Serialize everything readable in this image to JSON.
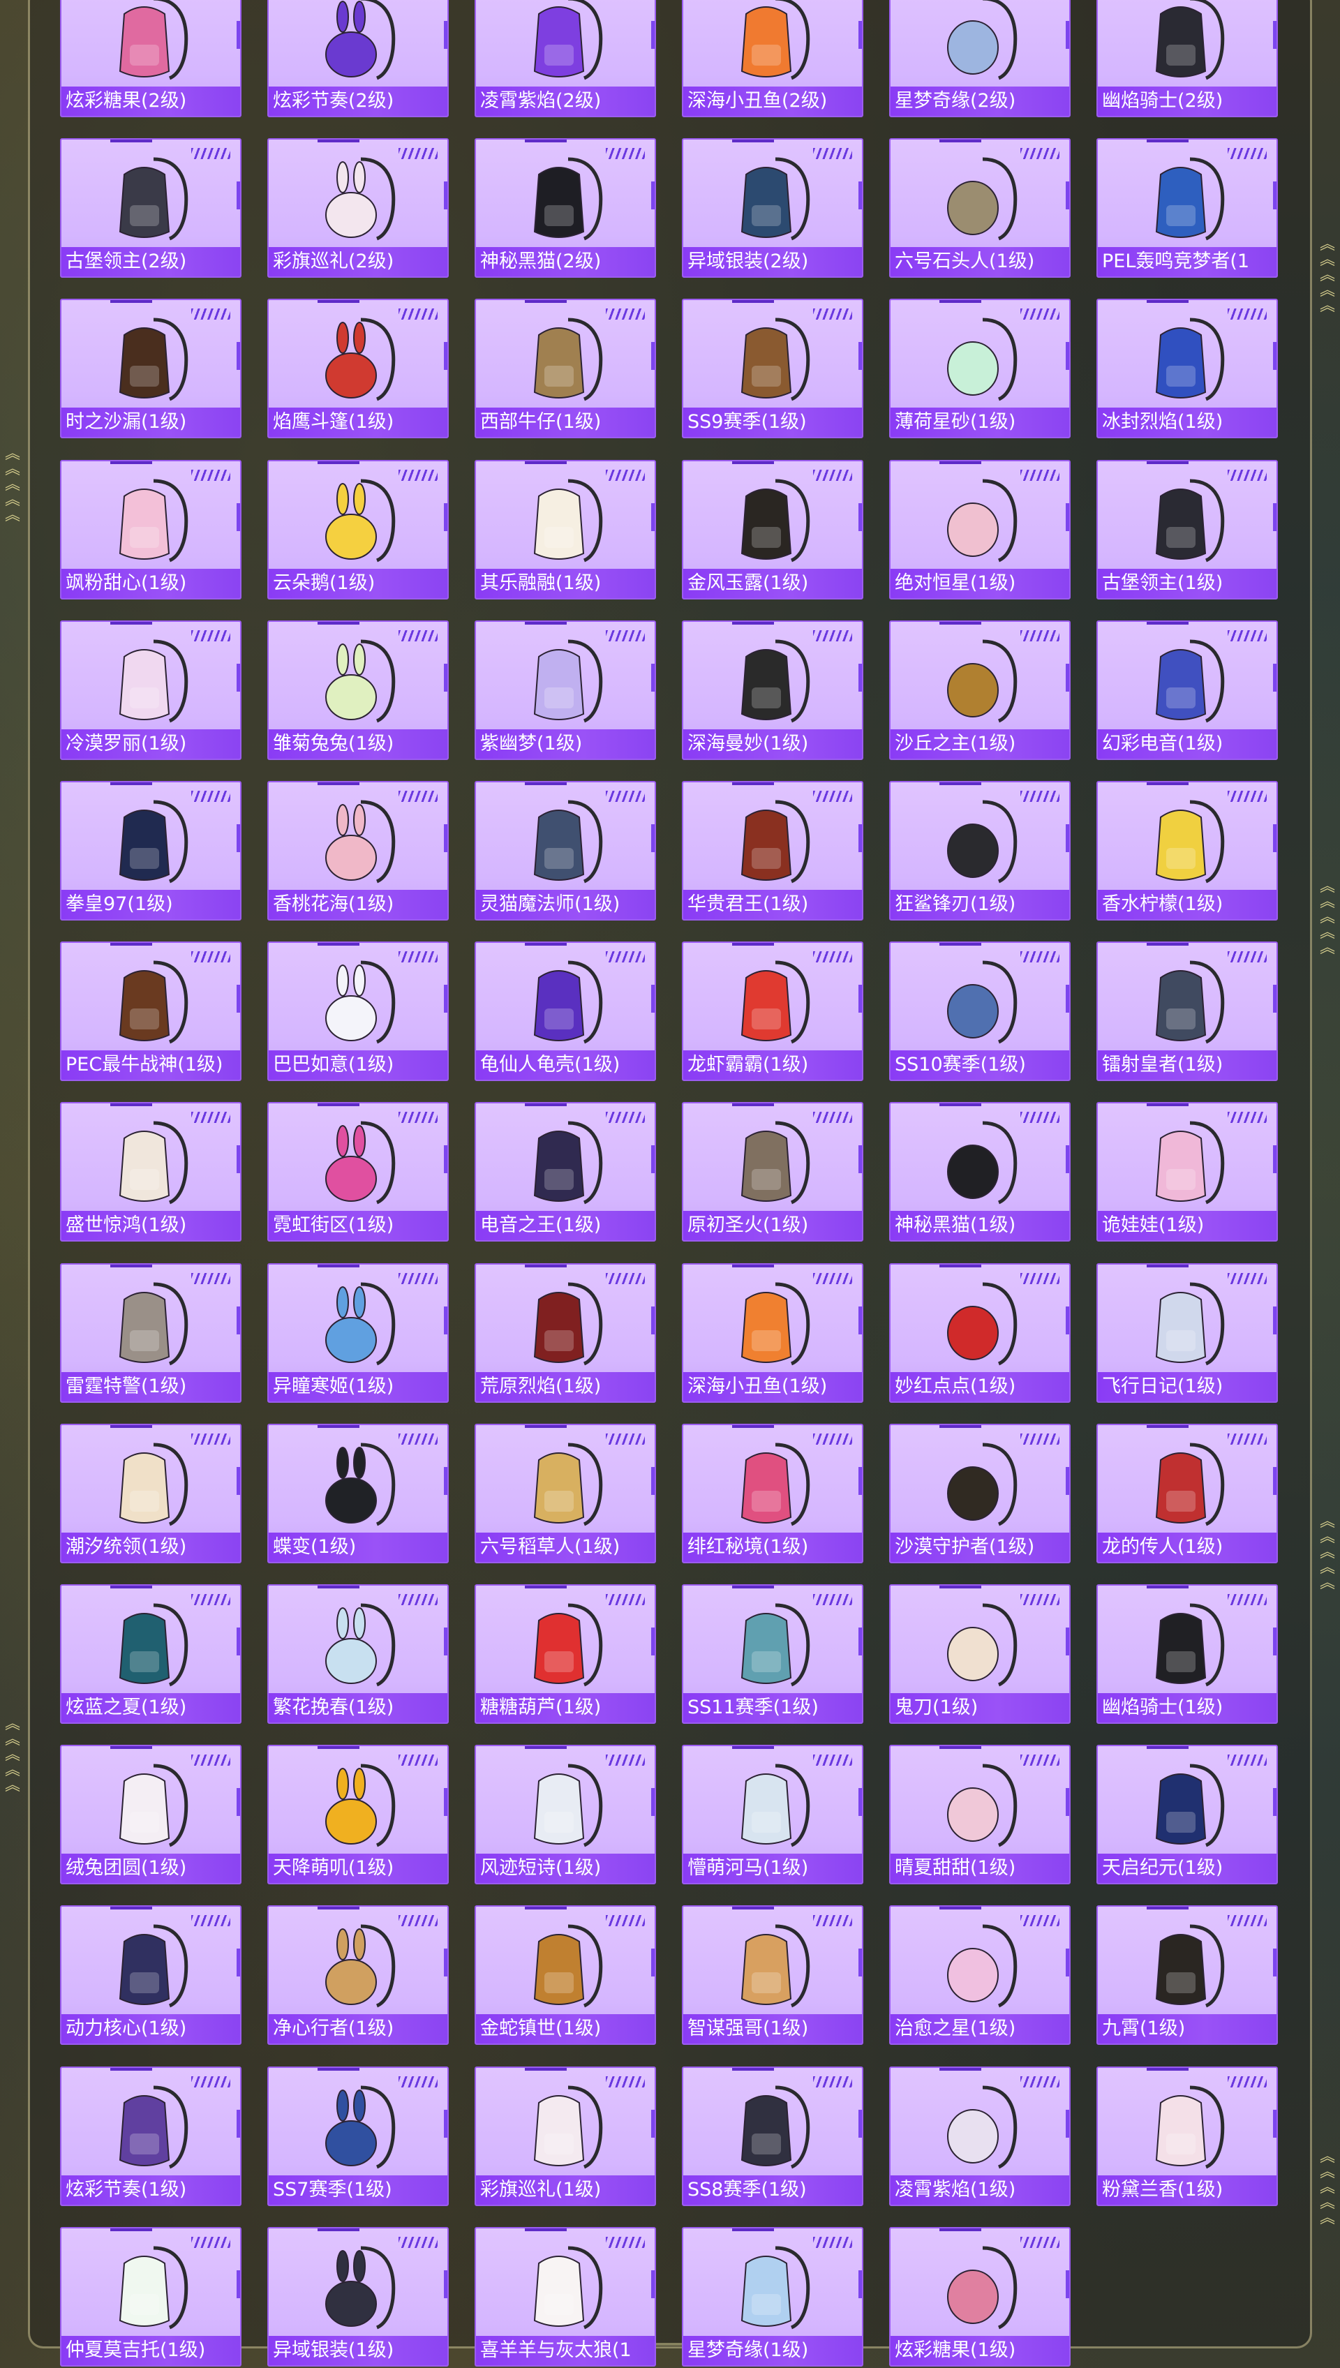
{
  "items": [
    "炫彩糖果(2级)",
    "炫彩节奏(2级)",
    "凌霄紫焰(2级)",
    "深海小丑鱼(2级)",
    "星梦奇缘(2级)",
    "幽焰骑士(2级)",
    "古堡领主(2级)",
    "彩旗巡礼(2级)",
    "神秘黑猫(2级)",
    "异域银装(2级)",
    "六号石头人(1级)",
    "PEL轰鸣竞梦者(1",
    "时之沙漏(1级)",
    "焰鹰斗篷(1级)",
    "西部牛仔(1级)",
    "SS9赛季(1级)",
    "薄荷星砂(1级)",
    "冰封烈焰(1级)",
    "飒粉甜心(1级)",
    "云朵鹅(1级)",
    "其乐融融(1级)",
    "金风玉露(1级)",
    "绝对恒星(1级)",
    "古堡领主(1级)",
    "冷漠罗丽(1级)",
    "雏菊兔兔(1级)",
    "紫幽梦(1级)",
    "深海曼妙(1级)",
    "沙丘之主(1级)",
    "幻彩电音(1级)",
    "拳皇97(1级)",
    "香桃花海(1级)",
    "灵猫魔法师(1级)",
    "华贵君王(1级)",
    "狂鲨锋刃(1级)",
    "香水柠檬(1级)",
    "PEC最牛战神(1级)",
    "巴巴如意(1级)",
    "龟仙人龟壳(1级)",
    "龙虾霸霸(1级)",
    "SS10赛季(1级)",
    "镭射皇者(1级)",
    "盛世惊鸿(1级)",
    "霓虹街区(1级)",
    "电音之王(1级)",
    "原初圣火(1级)",
    "神秘黑猫(1级)",
    "诡娃娃(1级)",
    "雷霆特警(1级)",
    "异瞳寒姬(1级)",
    "荒原烈焰(1级)",
    "深海小丑鱼(1级)",
    "妙红点点(1级)",
    "飞行日记(1级)",
    "潮汐统领(1级)",
    "蝶变(1级)",
    "六号稻草人(1级)",
    "绯红秘境(1级)",
    "沙漠守护者(1级)",
    "龙的传人(1级)",
    "炫蓝之夏(1级)",
    "繁花挽春(1级)",
    "糖糖葫芦(1级)",
    "SS11赛季(1级)",
    "鬼刀(1级)",
    "幽焰骑士(1级)",
    "绒兔团圆(1级)",
    "天降萌叽(1级)",
    "风迹短诗(1级)",
    "懵萌河马(1级)",
    "晴夏甜甜(1级)",
    "天启纪元(1级)",
    "动力核心(1级)",
    "净心行者(1级)",
    "金蛇镇世(1级)",
    "智谋强哥(1级)",
    "治愈之星(1级)",
    "九霄(1级)",
    "炫彩节奏(1级)",
    "SS7赛季(1级)",
    "彩旗巡礼(1级)",
    "SS8赛季(1级)",
    "凌霄紫焰(1级)",
    "粉黛兰香(1级)",
    "仲夏莫吉托(1级)",
    "异域银装(1级)",
    "喜羊羊与灰太狼(1",
    "星梦奇缘(1级)",
    "炫彩糖果(1级)"
  ],
  "bag_colors": [
    "#e06aa0",
    "#6a3ad0",
    "#7e3fe0",
    "#f07a30",
    "#9db5e0",
    "#2a2a33",
    "#3a3a48",
    "#f3e6ee",
    "#1e1e24",
    "#2c4a70",
    "#9b8d70",
    "#2e5fbf",
    "#4a2e1e",
    "#d03a30",
    "#a08050",
    "#8a5a30",
    "#c8f0d8",
    "#3050c0",
    "#f3c0d8",
    "#f5d040",
    "#f6efe2",
    "#2a2622",
    "#f0c0d0",
    "#2a2a33",
    "#f0d8f0",
    "#e0f0c0",
    "#c0b0f0",
    "#2a2a2a",
    "#b08030",
    "#4050c0",
    "#202a50",
    "#f0b8c8",
    "#405070",
    "#8a3020",
    "#2a2a2e",
    "#f0d040",
    "#6a3a20",
    "#f4f4fa",
    "#5a30c0",
    "#e03a30",
    "#5070b0",
    "#404a60",
    "#f0e6dc",
    "#e050a0",
    "#302a50",
    "#807060",
    "#202024",
    "#f0b8d8",
    "#9a9088",
    "#60a0e0",
    "#802020",
    "#f08030",
    "#d02a2a",
    "#d0d8ec",
    "#f0e0c8",
    "#202226",
    "#d8b060",
    "#e05080",
    "#302a22",
    "#c03030",
    "#206070",
    "#c8e0f0",
    "#e03030",
    "#60a0b0",
    "#f0e0d0",
    "#202024",
    "#f4eef4",
    "#f0b020",
    "#e8ecf4",
    "#d8e4f0",
    "#f0c8d8",
    "#203070",
    "#303060",
    "#d0a060",
    "#c08030",
    "#d8a060",
    "#f0c0e0",
    "#2a2622",
    "#6040a0",
    "#3050a0",
    "#f4eaf0",
    "#303040",
    "#e8e0f0",
    "#f4e0e8",
    "#f0f8f0",
    "#303040",
    "#f8f4f4",
    "#b0d0f0",
    "#e080a0"
  ]
}
